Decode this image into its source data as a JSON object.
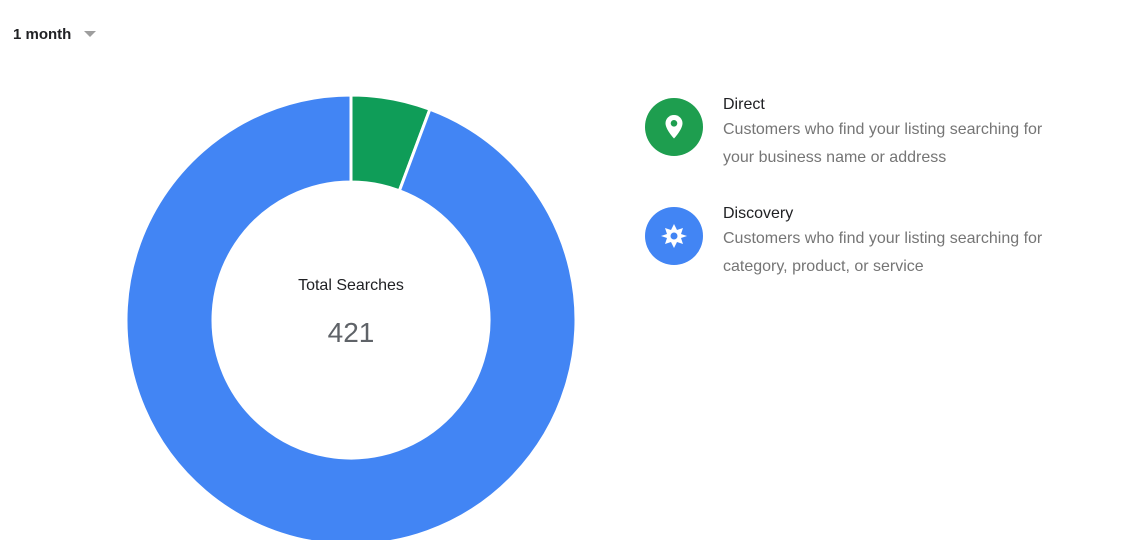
{
  "period_selector": {
    "value": "1 month",
    "icon": "dropdown-caret-icon"
  },
  "chart_data": {
    "type": "pie",
    "style": "donut",
    "center_label": "Total Searches",
    "center_value": "421",
    "total": 421,
    "series": [
      {
        "name": "Direct",
        "value": 24,
        "color": "#0f9d58"
      },
      {
        "name": "Discovery",
        "value": 397,
        "color": "#4285f4"
      }
    ]
  },
  "legend": [
    {
      "title": "Direct",
      "description_line1": "Customers who find your listing searching for",
      "description_line2": "your business name or address",
      "icon": "location-pin-icon",
      "color": "#1e9e4f"
    },
    {
      "title": "Discovery",
      "description_line1": "Customers who find your listing searching for",
      "description_line2": "category, product, or service",
      "icon": "discovery-compass-icon",
      "color": "#4285f4"
    }
  ]
}
